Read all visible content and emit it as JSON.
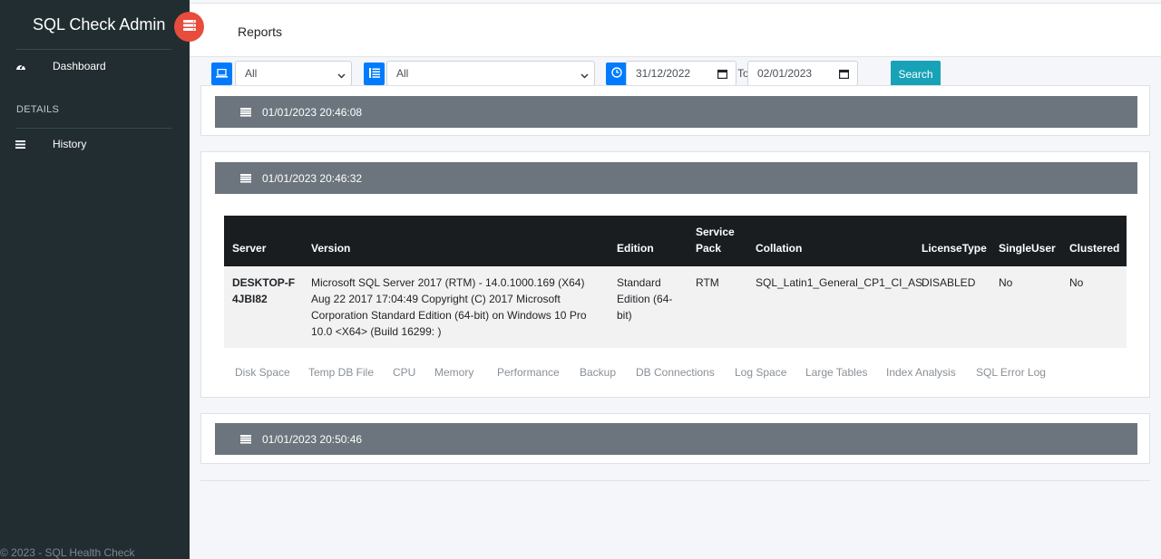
{
  "app": {
    "title": "SQL Check Admin",
    "footer": "© 2023 - SQL Health Check"
  },
  "sidebar": {
    "items": [
      {
        "label": "Dashboard",
        "icon": "tachometer-icon"
      },
      {
        "label": "History",
        "icon": "bars-icon"
      }
    ],
    "section_header": "DETAILS"
  },
  "topbar": {
    "title": "Reports"
  },
  "filters": {
    "server_select": "All",
    "category_select": "All",
    "date_from": "31/12/2022",
    "to_label": "To",
    "date_to": "02/01/2023",
    "search_label": "Search"
  },
  "reports": [
    {
      "timestamp": "01/01/2023 20:46:08"
    },
    {
      "timestamp": "01/01/2023 20:46:32"
    },
    {
      "timestamp": "01/01/2023 20:50:46"
    }
  ],
  "table": {
    "headers": {
      "server": "Server",
      "version": "Version",
      "edition": "Edition",
      "service_pack": "Service Pack",
      "collation": "Collation",
      "license_type": "LicenseType",
      "single_user": "SingleUser",
      "clustered": "Clustered"
    },
    "row": {
      "server": "DESKTOP-F4JBI82",
      "version": "Microsoft SQL Server 2017 (RTM) - 14.0.1000.169 (X64) Aug 22 2017 17:04:49 Copyright (C) 2017 Microsoft Corporation Standard Edition (64-bit) on Windows 10 Pro 10.0 <X64> (Build 16299: )",
      "edition": "Standard Edition (64-bit)",
      "service_pack": "RTM",
      "collation": "SQL_Latin1_General_CP1_CI_AS",
      "license_type": "DISABLED",
      "single_user": "No",
      "clustered": "No"
    }
  },
  "tabs": [
    "Disk Space",
    "Temp DB File",
    "CPU",
    "Memory",
    "Performance",
    "Backup",
    "DB Connections",
    "Log Space",
    "Large Tables",
    "Index Analysis",
    "SQL Error Log"
  ],
  "colors": {
    "sidebar_bg": "#222d32",
    "toggle": "#e74c3c",
    "primary": "#007bff",
    "search": "#17a2b8",
    "card_header": "#6c757d",
    "table_header": "#1a1d20"
  }
}
